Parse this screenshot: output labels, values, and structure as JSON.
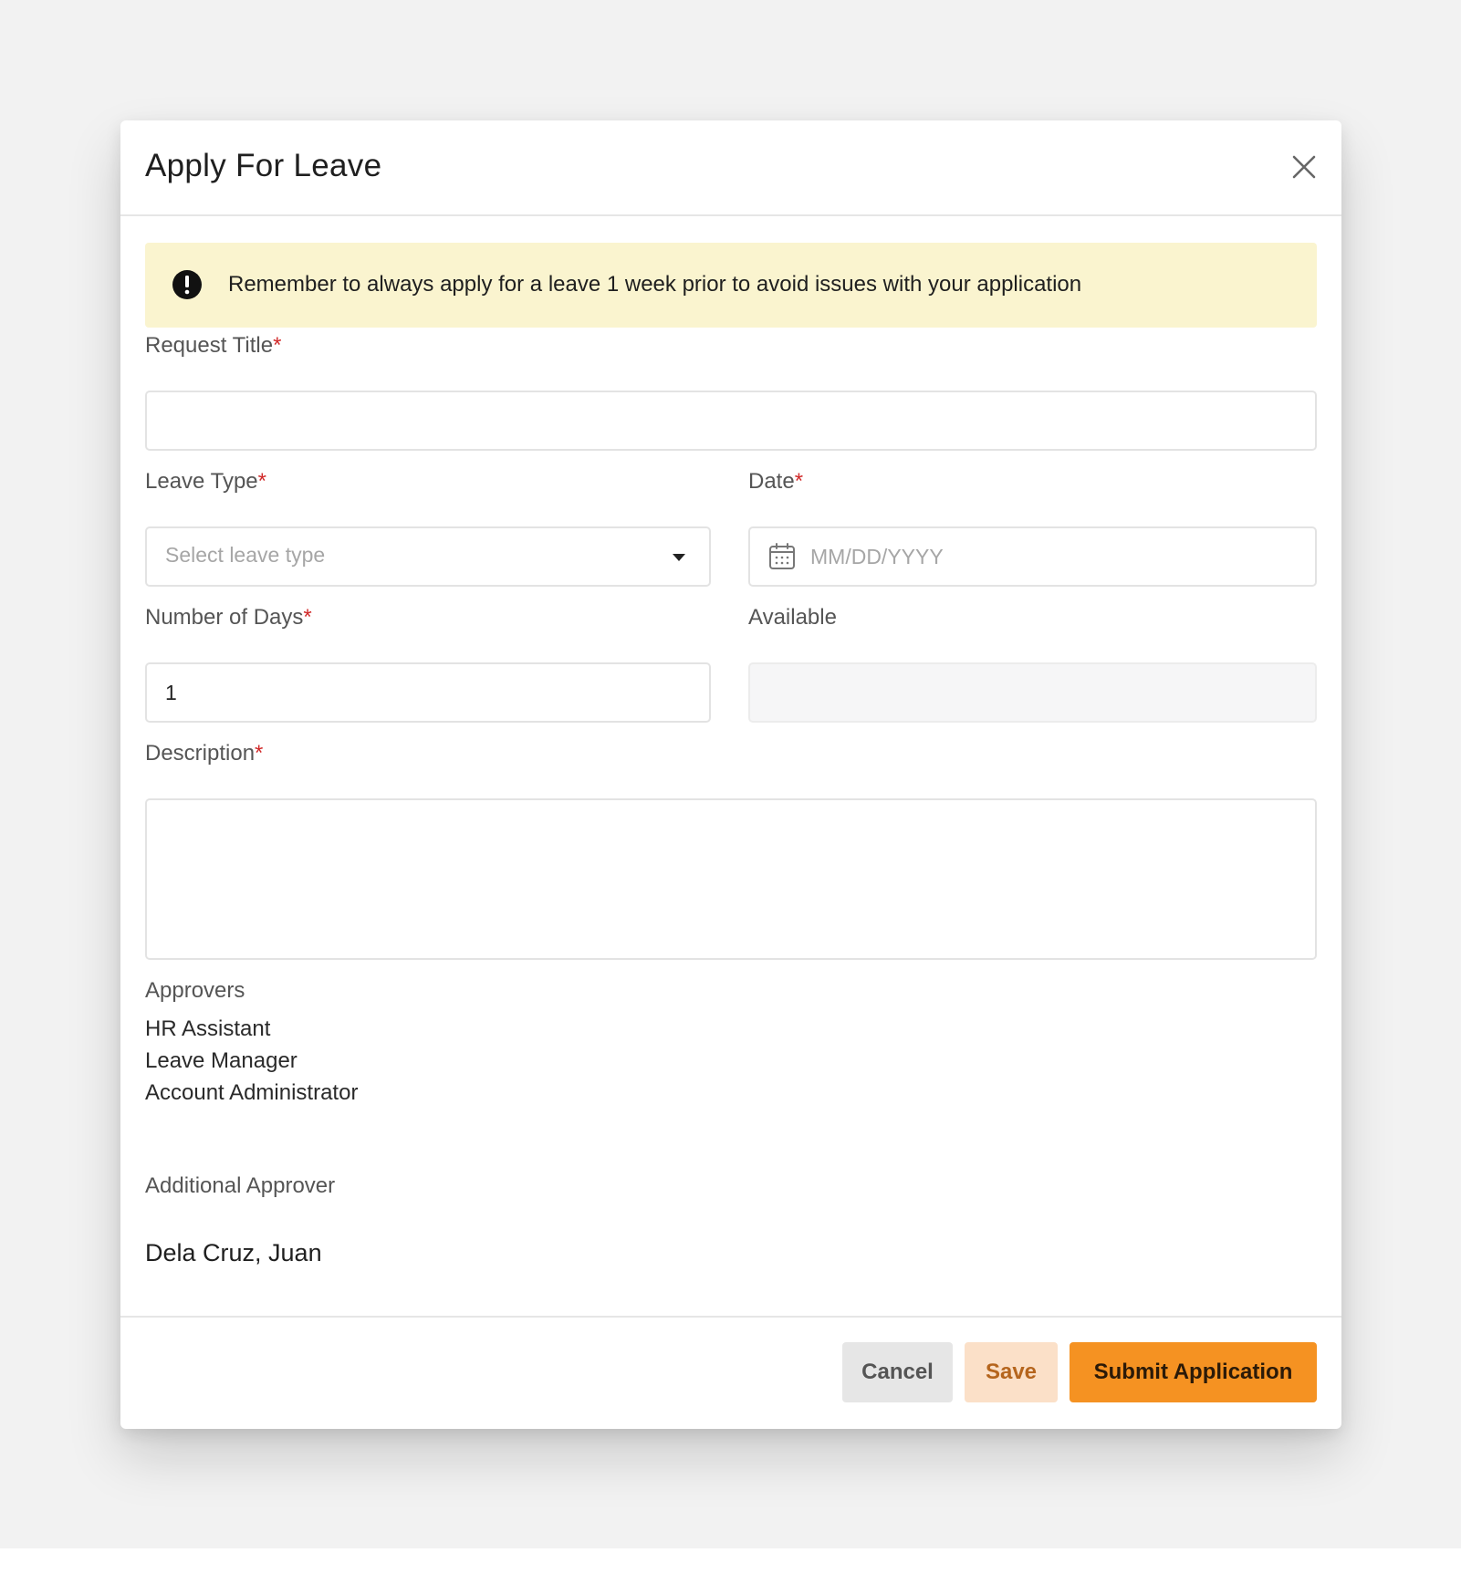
{
  "modal": {
    "title": "Apply For Leave",
    "close_icon": "close-icon"
  },
  "notice": {
    "icon": "exclamation-circle-icon",
    "text": "Remember to always apply for a leave 1 week prior to avoid issues with your application",
    "background": "#faf4cf"
  },
  "form": {
    "request_title": {
      "label": "Request Title",
      "required_mark": "*",
      "value": ""
    },
    "leave_type": {
      "label": "Leave Type",
      "required_mark": "*",
      "placeholder": "Select leave type",
      "icon": "caret-down-icon"
    },
    "date": {
      "label": "Date",
      "required_mark": "*",
      "placeholder": "MM/DD/YYYY",
      "icon": "calendar-icon"
    },
    "number_of_days": {
      "label": "Number of Days",
      "required_mark": "*",
      "value": "1"
    },
    "available": {
      "label": "Available",
      "value": ""
    },
    "description": {
      "label": "Description",
      "required_mark": "*",
      "value": ""
    }
  },
  "approvers": {
    "label": "Approvers",
    "items": [
      "HR Assistant",
      "Leave Manager",
      "Account Administrator"
    ]
  },
  "additional_approver": {
    "label": "Additional Approver",
    "name": "Dela Cruz, Juan"
  },
  "footer": {
    "cancel_label": "Cancel",
    "save_label": "Save",
    "submit_label": "Submit Application"
  },
  "colors": {
    "accent": "#f59222",
    "save_bg": "#fbe0c8",
    "cancel_bg": "#e6e6e6",
    "required": "#d12a2a"
  }
}
